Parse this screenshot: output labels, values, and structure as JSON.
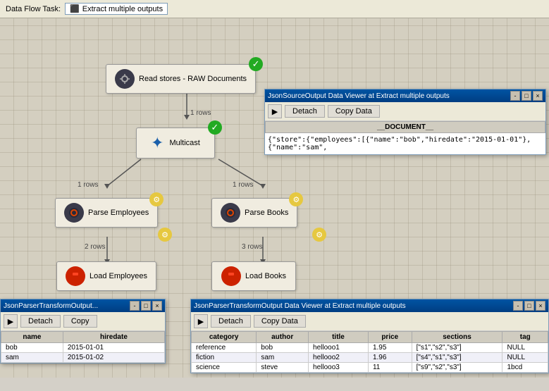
{
  "titlebar": {
    "label": "Data Flow Task:",
    "value": "Extract multiple outputs",
    "icon": "dataflow-icon"
  },
  "nodes": {
    "readStores": {
      "label": "Read stores - RAW Documents",
      "icon": "⬤"
    },
    "multicast": {
      "label": "Multicast"
    },
    "parseEmployees": {
      "label": "Parse Employees"
    },
    "parseBooks": {
      "label": "Parse Books"
    },
    "loadEmployees": {
      "label": "Load Employees"
    },
    "loadBooks": {
      "label": "Load Books"
    }
  },
  "rowLabels": {
    "readToMulti": "1 rows",
    "multiToEmployees": "1 rows",
    "multiToBooks": "1 rows",
    "employeesToLoad": "2 rows",
    "booksToLoad": "3 rows"
  },
  "jsonViewer": {
    "title": "JsonSourceOutput Data Viewer at Extract multiple outputs",
    "detachLabel": "Detach",
    "copyDataLabel": "Copy Data",
    "columnHeader": "__DOCUMENT__",
    "content": "{\"store\":{\"employees\":[{\"name\":\"bob\",\"hiredate\":\"2015-01-01\"},{\"name\":\"sam\","
  },
  "employeeViewer": {
    "title": "JsonParserTransformOutput...",
    "detachLabel": "Detach",
    "copyLabel": "Copy",
    "columns": [
      "name",
      "hiredate"
    ],
    "rows": [
      [
        "bob",
        "2015-01-01"
      ],
      [
        "sam",
        "2015-01-02"
      ]
    ]
  },
  "booksViewer": {
    "title": "JsonParserTransformOutput Data Viewer at Extract multiple outputs",
    "detachLabel": "Detach",
    "copyDataLabel": "Copy Data",
    "columns": [
      "category",
      "author",
      "title",
      "price",
      "sections",
      "tag"
    ],
    "rows": [
      [
        "reference",
        "bob",
        "hellooo1",
        "1.95",
        "[\"s1\",\"s2\",\"s3\"]",
        "NULL"
      ],
      [
        "fiction",
        "sam",
        "hellooo2",
        "1.96",
        "[\"s4\",\"s1\",\"s3\"]",
        "NULL"
      ],
      [
        "science",
        "steve",
        "hellooo3",
        "11",
        "[\"s9\",\"s2\",\"s3\"]",
        "1bcd"
      ]
    ]
  }
}
